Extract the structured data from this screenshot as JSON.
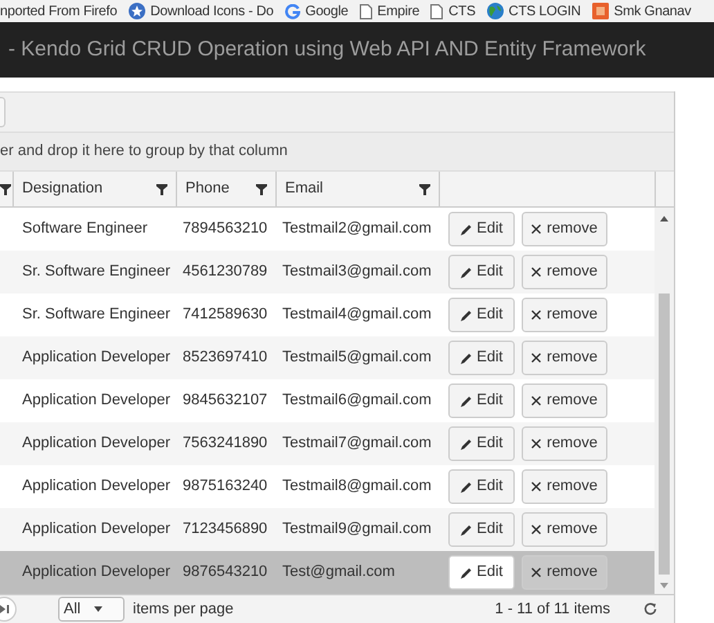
{
  "bookmarks": [
    {
      "label": "nported From Firefo",
      "kind": "none"
    },
    {
      "label": "Download Icons - Do",
      "kind": "star"
    },
    {
      "label": "Google",
      "kind": "google"
    },
    {
      "label": "Empire",
      "kind": "page"
    },
    {
      "label": "CTS",
      "kind": "page"
    },
    {
      "label": "CTS LOGIN",
      "kind": "globe"
    },
    {
      "label": "Smk Gnanav",
      "kind": "app"
    }
  ],
  "page_title": "- Kendo Grid CRUD Operation using Web API AND Entity Framework",
  "group_hint": "er and drop it here to group by that column",
  "columns": [
    "Designation",
    "Phone",
    "Email"
  ],
  "rows": [
    {
      "designation": "Software Engineer",
      "phone": "7894563210",
      "email": "Testmail2@gmail.com",
      "edit": "Edit",
      "remove": "remove",
      "hovered": false
    },
    {
      "designation": "Sr. Software Engineer",
      "phone": "4561230789",
      "email": "Testmail3@gmail.com",
      "edit": "Edit",
      "remove": "remove",
      "hovered": false
    },
    {
      "designation": "Sr. Software Engineer",
      "phone": "7412589630",
      "email": "Testmail4@gmail.com",
      "edit": "Edit",
      "remove": "remove",
      "hovered": false
    },
    {
      "designation": "Application Developer",
      "phone": "8523697410",
      "email": "Testmail5@gmail.com",
      "edit": "Edit",
      "remove": "remove",
      "hovered": false
    },
    {
      "designation": "Application Developer",
      "phone": "9845632107",
      "email": "Testmail6@gmail.com",
      "edit": "Edit",
      "remove": "remove",
      "hovered": false
    },
    {
      "designation": "Application Developer",
      "phone": "7563241890",
      "email": "Testmail7@gmail.com",
      "edit": "Edit",
      "remove": "remove",
      "hovered": false
    },
    {
      "designation": "Application Developer",
      "phone": "9875163240",
      "email": "Testmail8@gmail.com",
      "edit": "Edit",
      "remove": "remove",
      "hovered": false
    },
    {
      "designation": "Application Developer",
      "phone": "7123456890",
      "email": "Testmail9@gmail.com",
      "edit": "Edit",
      "remove": "remove",
      "hovered": false
    },
    {
      "designation": "Application Developer",
      "phone": "9876543210",
      "email": "Test@gmail.com",
      "edit": "Edit",
      "remove": "remove",
      "hovered": true
    }
  ],
  "pager": {
    "page_size": "All",
    "page_size_label": "items per page",
    "summary": "1 - 11 of 11 items"
  }
}
